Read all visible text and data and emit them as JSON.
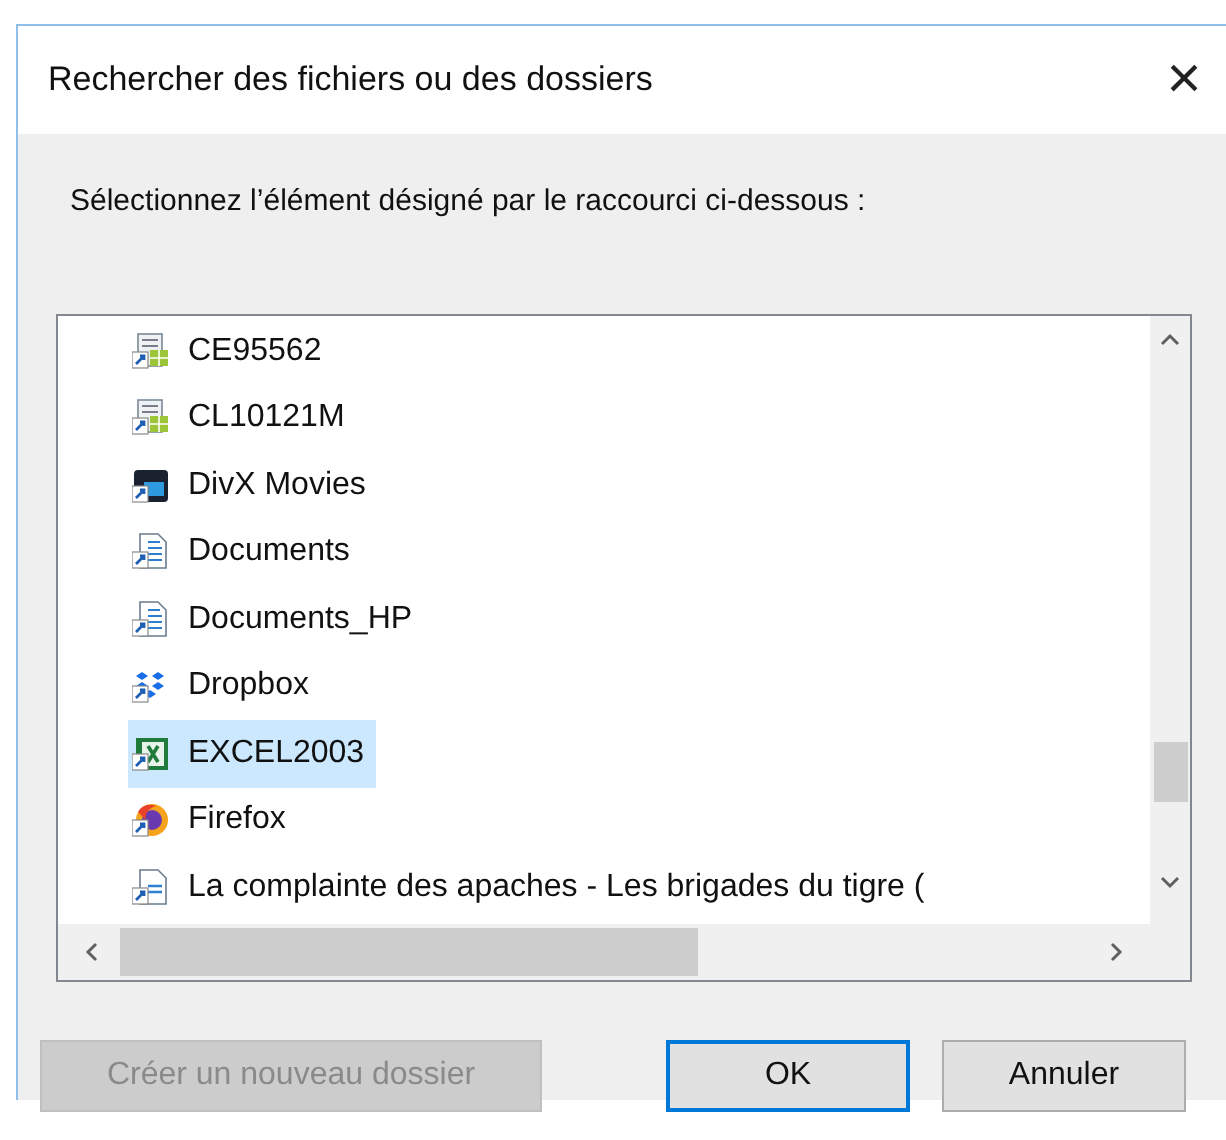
{
  "window": {
    "title": "Rechercher des fichiers ou des dossiers",
    "close": "×"
  },
  "instruction": "Sélectionnez l’élément désigné par le raccourci ci-dessous :",
  "tree": {
    "items": [
      {
        "label": "CE95562",
        "kind": "sheet",
        "selected": false
      },
      {
        "label": "CL10121M",
        "kind": "sheet",
        "selected": false
      },
      {
        "label": "DivX Movies",
        "kind": "media",
        "selected": false
      },
      {
        "label": "Documents",
        "kind": "document",
        "selected": false
      },
      {
        "label": "Documents_HP",
        "kind": "document",
        "selected": false
      },
      {
        "label": "Dropbox",
        "kind": "dropbox",
        "selected": false
      },
      {
        "label": "EXCEL2003",
        "kind": "excel",
        "selected": true
      },
      {
        "label": "Firefox",
        "kind": "browser",
        "selected": false
      },
      {
        "label": "La complainte des apaches - Les brigades du tigre (",
        "kind": "file",
        "selected": false
      }
    ]
  },
  "buttons": [
    {
      "label": "Créer un nouveau dossier",
      "disabled": true,
      "default": false
    },
    {
      "label": "OK",
      "disabled": false,
      "default": true
    },
    {
      "label": "Annuler",
      "disabled": false,
      "default": false
    }
  ]
}
